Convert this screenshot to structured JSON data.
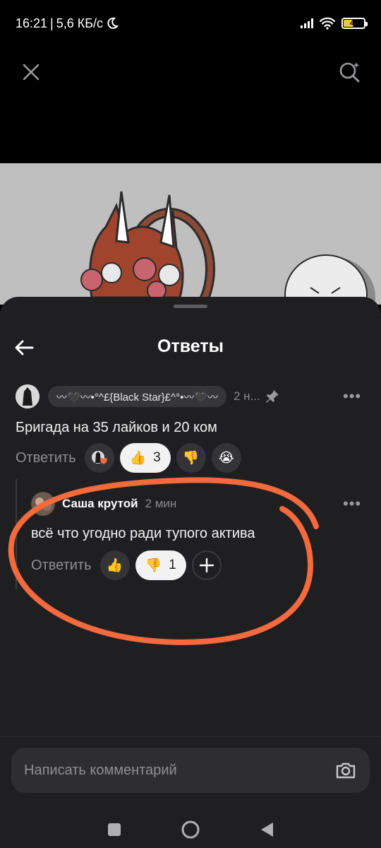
{
  "status_bar": {
    "time": "16:21",
    "speed": "5,6 КБ/с",
    "battery": "47"
  },
  "sheet": {
    "title": "Ответы"
  },
  "parent_comment": {
    "nickname": "〰🖤〰•°^£{Black Star}£^°•〰🖤〰",
    "time": "2 н...",
    "text": "Бригада на 35 лайков и 20 ком",
    "reply_label": "Ответить",
    "likes": "3"
  },
  "reply_comment": {
    "author": "Саша крутой",
    "time": "2 мин",
    "text": "всё что угодно ради тупого актива",
    "reply_label": "Ответить",
    "dislikes": "1"
  },
  "input": {
    "placeholder": "Написать комментарий"
  },
  "colors": {
    "highlight": "#f26a3d",
    "sheet_bg": "#1f1f21"
  }
}
